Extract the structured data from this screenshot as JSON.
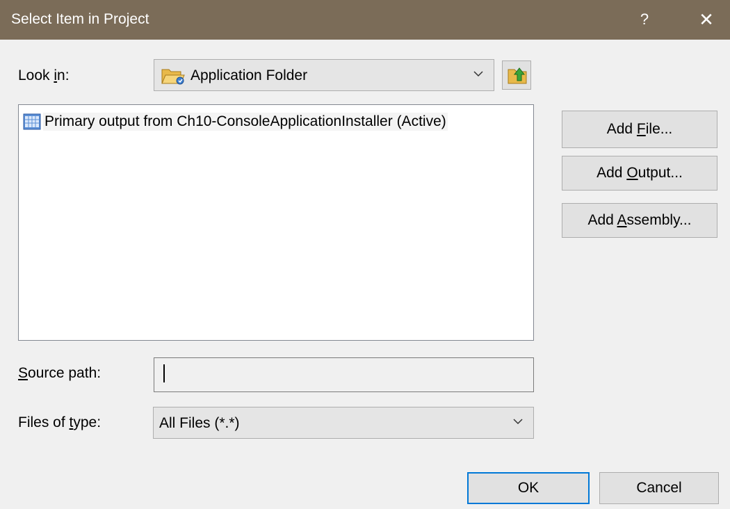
{
  "window": {
    "title": "Select Item in Project",
    "help_glyph": "?",
    "close_glyph": "✕"
  },
  "look_in": {
    "label_pre": "Look ",
    "label_mnemonic": "i",
    "label_post": "n:",
    "value": "Application Folder",
    "icon": "folder-icon",
    "up_icon": "up-one-level-icon"
  },
  "file_list": {
    "items": [
      {
        "label": "Primary output from Ch10-ConsoleApplicationInstaller (Active)",
        "icon": "project-output-icon"
      }
    ]
  },
  "buttons": {
    "add_file": {
      "pre": "Add ",
      "mnemonic": "F",
      "post": "ile..."
    },
    "add_output": {
      "pre": "Add ",
      "mnemonic": "O",
      "post": "utput..."
    },
    "add_assembly": {
      "pre": "Add ",
      "mnemonic": "A",
      "post": "ssembly..."
    },
    "ok": "OK",
    "cancel": "Cancel"
  },
  "source_path": {
    "label_mnemonic": "S",
    "label_post": "ource path:",
    "value": ""
  },
  "files_of_type": {
    "label_pre": "Files of ",
    "label_mnemonic": "t",
    "label_post": "ype:",
    "value": "All Files (*.*)"
  },
  "colors": {
    "titlebar": "#7b6c58",
    "default_button_border": "#0078d7"
  }
}
